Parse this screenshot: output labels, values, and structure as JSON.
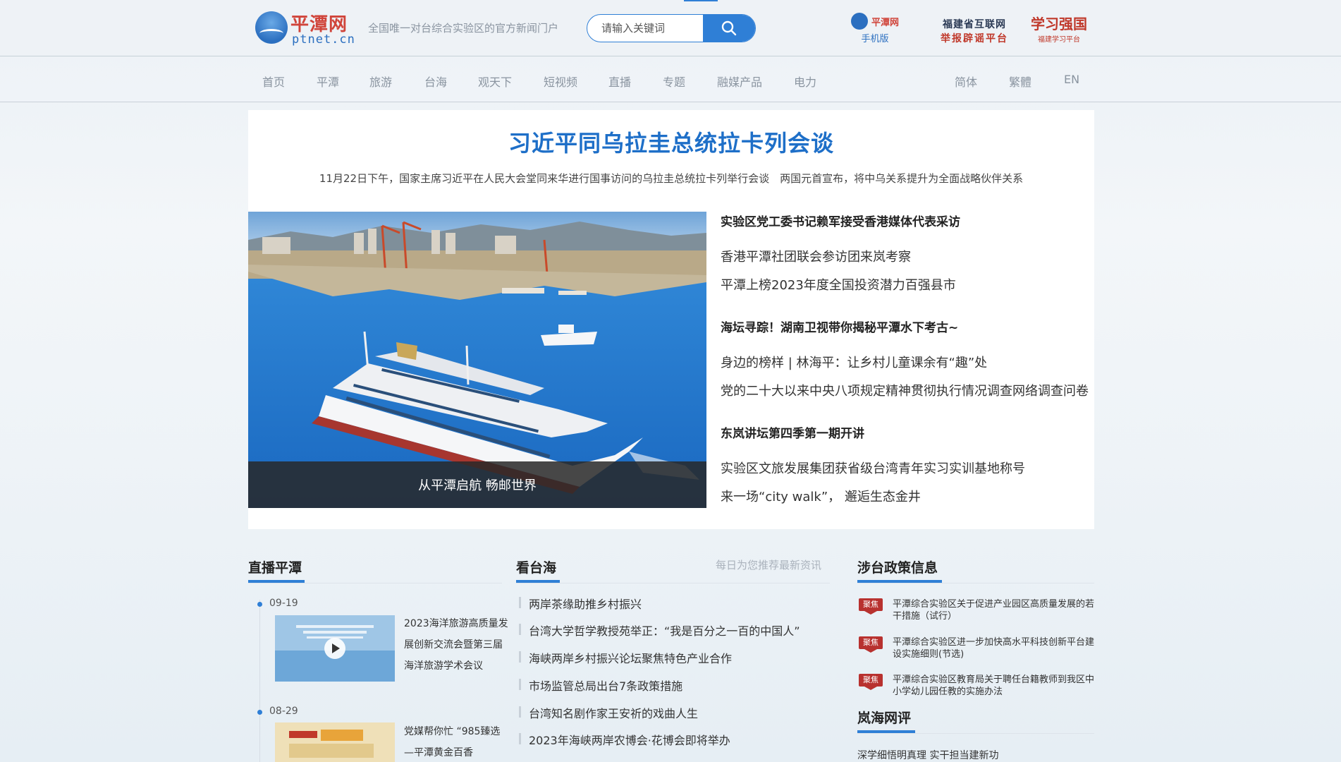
{
  "header": {
    "logo_cn": "平潭网",
    "logo_en": "ptnet.cn",
    "slogan": "全国唯一对台综合实验区的官方新闻门户",
    "search_placeholder": "请输入关键词",
    "mobile_title": "平潭网",
    "mobile_label": "手机版",
    "report_line1": "福建省互联网",
    "report_line2": "举报辟谣平台",
    "xuexi_line1": "学习强国",
    "xuexi_line2": "福建学习平台"
  },
  "nav": {
    "items": [
      "首页",
      "平潭",
      "旅游",
      "台海",
      "观天下",
      "短视频",
      "直播",
      "专题",
      "融媒产品",
      "电力"
    ],
    "lang": [
      "简体",
      "繁體",
      "EN"
    ]
  },
  "top_story": {
    "headline": "习近平同乌拉圭总统拉卡列会谈",
    "summary": "11月22日下午，国家主席习近平在人民大会堂同来华进行国事访问的乌拉圭总统拉卡列举行会谈　两国元首宣布，将中乌关系提升为全面战略伙伴关系",
    "photo_caption": "从平潭启航 畅邮世界"
  },
  "news_list": [
    {
      "text": "实验区党工委书记赖军接受香港媒体代表采访",
      "bold": true
    },
    {
      "text": "香港平潭社团联会参访团来岚考察",
      "bold": false
    },
    {
      "text": "平潭上榜2023年度全国投资潜力百强县市",
      "bold": false
    },
    {
      "text": "海坛寻踪！湖南卫视带你揭秘平潭水下考古~",
      "bold": true
    },
    {
      "text": "身边的榜样 | 林海平：让乡村儿童课余有“趣”处",
      "bold": false
    },
    {
      "text": "党的二十大以来中央八项规定精神贯彻执行情况调查网络调查问卷",
      "bold": false
    },
    {
      "text": "东岚讲坛第四季第一期开讲",
      "bold": true
    },
    {
      "text": "实验区文旅发展集团获省级台湾青年实习实训基地称号",
      "bold": false
    },
    {
      "text": "来一场“city walk”， 邂逅生态金井",
      "bold": false
    }
  ],
  "live": {
    "title": "直播平潭",
    "items": [
      {
        "date": "09-19",
        "text": "2023海洋旅游高质量发展创新交流会暨第三届海洋旅游学术会议"
      },
      {
        "date": "08-29",
        "text": "党媒帮你忙 “985臻选—平潭黄金百香"
      }
    ]
  },
  "taiwan": {
    "title": "看台海",
    "hint": "每日为您推荐最新资讯",
    "items": [
      "两岸茶缘助推乡村振兴",
      "台湾大学哲学教授苑举正：“我是百分之一百的中国人”",
      "海峡两岸乡村振兴论坛聚焦特色产业合作",
      "市场监管总局出台7条政策措施",
      "台湾知名剧作家王安祈的戏曲人生",
      "2023年海峡两岸农博会·花博会即将举办"
    ]
  },
  "policy": {
    "title": "涉台政策信息",
    "badge": "聚焦",
    "items": [
      "平潭综合实验区关于促进产业园区高质量发展的若干措施（试行）",
      "平潭综合实验区进一步加快高水平科技创新平台建设实施细则(节选)",
      "平潭综合实验区教育局关于聘任台籍教师到我区中小学幼儿园任教的实施办法"
    ]
  },
  "comment": {
    "title": "岚海网评",
    "items": [
      "深学细悟明真理 实干担当建新功"
    ]
  },
  "colors": {
    "accent": "#2f7fd6",
    "headline": "#1e6fc8",
    "badge": "#b8312f"
  }
}
